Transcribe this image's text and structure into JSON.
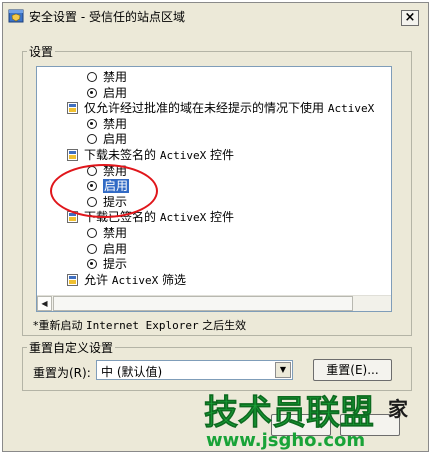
{
  "window": {
    "title": "安全设置 - 受信任的站点区域",
    "close_glyph": "×"
  },
  "settings_group": {
    "label": "设置",
    "rows": [
      {
        "kind": "radio",
        "checked": false,
        "text": "禁用"
      },
      {
        "kind": "radio",
        "checked": true,
        "text": "启用"
      },
      {
        "kind": "heading",
        "text_cn": "仅允许经过批准的域在未经提示的情况下使用 ",
        "text_mono": "ActiveX"
      },
      {
        "kind": "radio",
        "checked": true,
        "text": "禁用"
      },
      {
        "kind": "radio",
        "checked": false,
        "text": "启用"
      },
      {
        "kind": "heading",
        "text_cn": "下载未签名的 ",
        "text_mono": "ActiveX",
        "text_tail": " 控件"
      },
      {
        "kind": "radio",
        "checked": false,
        "text": "禁用"
      },
      {
        "kind": "radio",
        "checked": true,
        "text": "启用",
        "selected": true
      },
      {
        "kind": "radio",
        "checked": false,
        "text": "提示"
      },
      {
        "kind": "heading",
        "text_cn": "下载已签名的 ",
        "text_mono": "ActiveX",
        "text_tail": " 控件"
      },
      {
        "kind": "radio",
        "checked": false,
        "text": "禁用"
      },
      {
        "kind": "radio",
        "checked": false,
        "text": "启用"
      },
      {
        "kind": "radio",
        "checked": true,
        "text": "提示"
      },
      {
        "kind": "heading",
        "text_cn": "允许 ",
        "text_mono": "ActiveX",
        "text_tail": " 筛选"
      }
    ],
    "note_prefix": "*重新启动 ",
    "note_mono": "Internet Explorer",
    "note_suffix": " 之后生效"
  },
  "reset_group": {
    "label": "重置自定义设置",
    "reset_to_label": "重置为(R):",
    "select_value": "中 (默认值)",
    "reset_button": "重置(E)..."
  },
  "watermark": {
    "main": "技术员联盟",
    "url": "www.jsgho.com",
    "tag": "家"
  },
  "colors": {
    "dialog_bg": "#ece9d8",
    "annotation_red": "#e0161b",
    "selection_blue": "#316ac5",
    "watermark_green": "#19a338"
  }
}
